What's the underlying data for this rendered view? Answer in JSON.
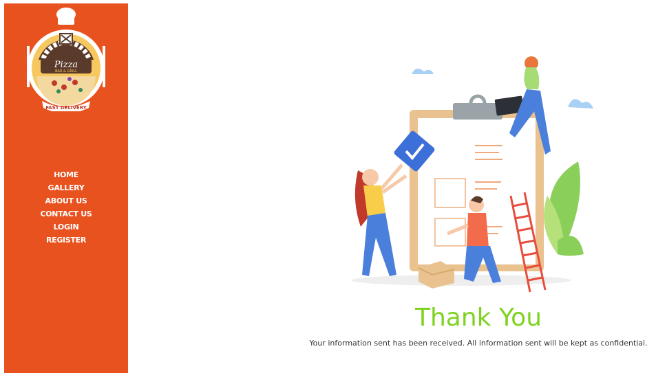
{
  "brand": {
    "name": "Pizza",
    "tagline": "BAR & GRILL",
    "ribbon": "FAST DELIVERY"
  },
  "nav": {
    "items": [
      {
        "label": "HOME"
      },
      {
        "label": "GALLERY"
      },
      {
        "label": "ABOUT US"
      },
      {
        "label": "CONTACT US"
      },
      {
        "label": "LOGIN"
      },
      {
        "label": "REGISTER"
      }
    ]
  },
  "main": {
    "title": "Thank You",
    "message": "Your information sent has been received. All information sent will be kept as confidential."
  },
  "colors": {
    "sidebar": "#e8521f",
    "title": "#7ed321",
    "text": "#333333"
  },
  "icons": {
    "logo": "pizza-logo-icon",
    "check": "check-icon"
  }
}
